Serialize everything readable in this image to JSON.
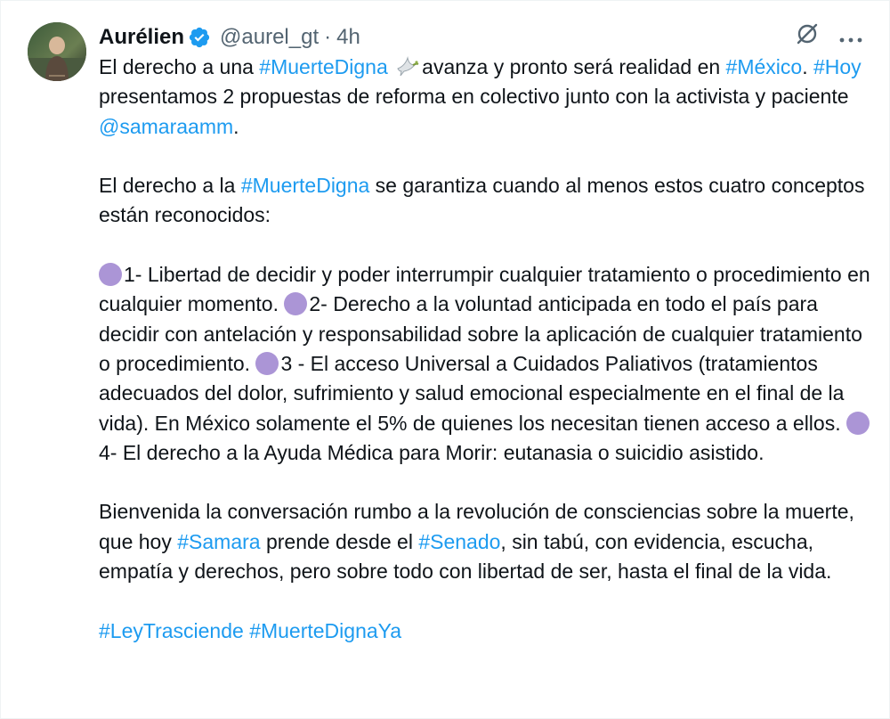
{
  "author": {
    "display_name": "Aurélien",
    "handle": "@aurel_gt",
    "separator": "·",
    "time": "4h",
    "verified_icon": "verified-badge-icon",
    "avatar_icon": "avatar"
  },
  "actions": {
    "grok_icon": "grok-icon",
    "more_icon": "more-options-icon"
  },
  "colors": {
    "link": "#1d9bf0",
    "text": "#0f1419",
    "muted": "#536471",
    "bullet": "#ab95d6",
    "verified": "#1d9bf0"
  },
  "content": {
    "p1": {
      "t1": "El derecho a una ",
      "h1": "#MuerteDigna",
      "dove_icon": "dove-icon",
      "t2": "avanza y pronto será realidad en ",
      "h2": "#México",
      "t3": ". ",
      "h3": "#Hoy",
      "t4": " presentamos 2 propuestas de reforma en colectivo junto con la activista y paciente ",
      "m1": "@samaraamm",
      "t5": "."
    },
    "p2": {
      "t1": "El derecho a la ",
      "h1": "#MuerteDigna",
      "t2": " se garantiza cuando al menos estos cuatro conceptos están reconocidos:"
    },
    "p3": {
      "bullet_icon": "purple-circle-icon",
      "i1": "1- Libertad de decidir y poder interrumpir cualquier tratamiento o procedimiento en cualquier momento. ",
      "i2": "2- Derecho a la voluntad anticipada en todo el país para decidir con antelación y responsabilidad sobre la aplicación de cualquier tratamiento o procedimiento. ",
      "i3": "3 - El acceso Universal a Cuidados Paliativos (tratamientos adecuados del dolor, sufrimiento y salud emocional especialmente en el final de la vida). En México solamente el 5% de quienes los necesitan tienen acceso a ellos. ",
      "i4": "4- El derecho a la Ayuda Médica para Morir: eutanasia o suicidio asistido."
    },
    "p4": {
      "t1": "Bienvenida la conversación rumbo a la revolución de consciencias sobre la muerte, que hoy ",
      "h1": "#Samara",
      "t2": " prende desde el ",
      "h2": "#Senado",
      "t3": ", sin tabú, con evidencia, escucha, empatía y derechos, pero sobre todo con libertad de ser, hasta el final de la vida."
    },
    "p5": {
      "h1": "#LeyTrasciende",
      "t1": " ",
      "h2": "#MuerteDignaYa"
    }
  }
}
